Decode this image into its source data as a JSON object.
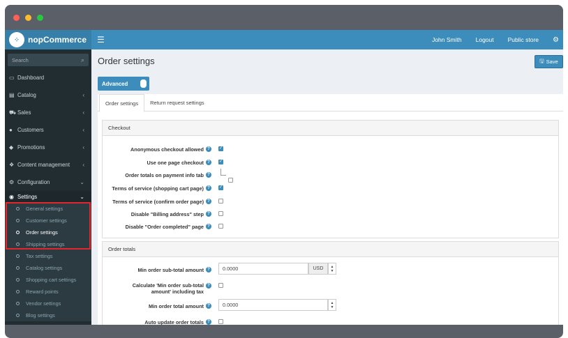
{
  "app": {
    "logo_text": "nopCommerce"
  },
  "topnav": {
    "user": "John Smith",
    "logout": "Logout",
    "public_store": "Public store"
  },
  "search": {
    "placeholder": "Search"
  },
  "sidebar": {
    "items": [
      {
        "label": "Dashboard",
        "icon": "monitor-icon",
        "chevron": ""
      },
      {
        "label": "Catalog",
        "icon": "book-icon",
        "chevron": "‹"
      },
      {
        "label": "Sales",
        "icon": "cart-icon",
        "chevron": "‹"
      },
      {
        "label": "Customers",
        "icon": "user-icon",
        "chevron": "‹"
      },
      {
        "label": "Promotions",
        "icon": "tag-icon",
        "chevron": "‹"
      },
      {
        "label": "Content management",
        "icon": "cubes-icon",
        "chevron": "‹"
      },
      {
        "label": "Configuration",
        "icon": "gears-icon",
        "chevron": "⌄"
      }
    ],
    "settings_label": "Settings",
    "settings_chevron": "⌄",
    "sub_items": [
      "General settings",
      "Customer settings",
      "Order settings",
      "Shipping settings",
      "Tax settings",
      "Catalog settings",
      "Shopping cart settings",
      "Reward points",
      "Vendor settings",
      "Blog settings"
    ],
    "current_sub_item": "Order settings"
  },
  "page": {
    "title": "Order settings",
    "save_label": "Save",
    "advanced_label": "Advanced"
  },
  "tabs": [
    "Order settings",
    "Return request settings"
  ],
  "checkout": {
    "heading": "Checkout",
    "rows": [
      {
        "label": "Anonymous checkout allowed",
        "checked": true
      },
      {
        "label": "Use one page checkout",
        "checked": true
      },
      {
        "label": "Order totals on payment info tab",
        "checked": false
      },
      {
        "label": "Terms of service (shopping cart page)",
        "checked": true
      },
      {
        "label": "Terms of service (confirm order page)",
        "checked": false
      },
      {
        "label": "Disable \"Billing address\" step",
        "checked": false
      },
      {
        "label": "Disable \"Order completed\" page",
        "checked": false
      }
    ]
  },
  "order_totals": {
    "heading": "Order totals",
    "min_subtotal_label": "Min order sub-total amount",
    "min_subtotal_value": "0.0000",
    "currency": "USD",
    "calc_label_1": "Calculate 'Min order sub-total",
    "calc_label_2": "amount' including tax",
    "min_total_label": "Min order total amount",
    "min_total_value": "0.0000",
    "auto_update_label": "Auto update order totals"
  },
  "colors": {
    "primary": "#3c8dbc",
    "sidebar": "#222d32",
    "highlight": "#e3262b"
  }
}
